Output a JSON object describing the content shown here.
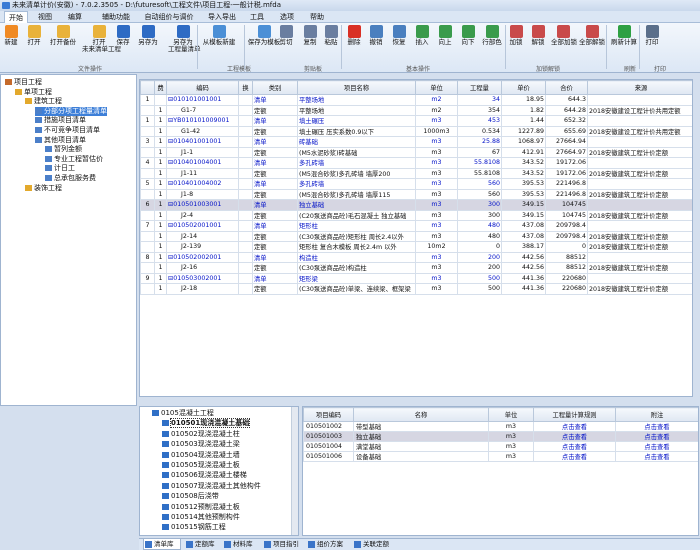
{
  "window": {
    "title": "未来清单计价(安徽) - 7.0.2.3505 - D:\\futuresoft\\工程文件\\项目工程-一般计税.mfda"
  },
  "tabs": [
    "开始",
    "视图",
    "编算",
    "辅助功能",
    "自动组价与调价",
    "导入导出",
    "工具",
    "选项",
    "帮助"
  ],
  "ribbon": {
    "buttons": [
      {
        "label": "新建",
        "icon": "new-file-icon",
        "color": "#f08a24"
      },
      {
        "label": "打开",
        "icon": "open-folder-icon",
        "color": "#e9b23a"
      },
      {
        "label": "打开备份",
        "icon": "backup-folder-icon",
        "color": "#e9b23a"
      },
      {
        "label": "打开\n未来清单工程",
        "icon": "open-project-icon",
        "color": "#e9b23a"
      },
      {
        "label": "保存",
        "icon": "save-icon",
        "color": "#2e6bc4"
      },
      {
        "label": "另存为",
        "icon": "save-as-icon",
        "color": "#2e6bc4"
      },
      {
        "label": "另存为\n工程量清单",
        "icon": "save-as-list-icon",
        "color": "#2e6bc4"
      },
      {
        "label": "从模板新建",
        "icon": "template-new-icon",
        "color": "#4b8fd6"
      },
      {
        "label": "保存为模板",
        "icon": "save-template-icon",
        "color": "#4b8fd6"
      },
      {
        "label": "剪切",
        "icon": "cut-icon",
        "color": "#6a7ea0"
      },
      {
        "label": "复制",
        "icon": "copy-icon",
        "color": "#6a7ea0"
      },
      {
        "label": "粘贴",
        "icon": "paste-icon",
        "color": "#6a7ea0"
      },
      {
        "label": "删除",
        "icon": "delete-icon",
        "color": "#d93025"
      },
      {
        "label": "撤销",
        "icon": "undo-icon",
        "color": "#4a7fbf"
      },
      {
        "label": "恢复",
        "icon": "redo-icon",
        "color": "#4a7fbf"
      },
      {
        "label": "插入",
        "icon": "insert-icon",
        "color": "#3a9b4c"
      },
      {
        "label": "向上",
        "icon": "move-up-icon",
        "color": "#3a9b4c"
      },
      {
        "label": "向下",
        "icon": "move-down-icon",
        "color": "#3a9b4c"
      },
      {
        "label": "行部色",
        "icon": "row-color-icon",
        "color": "#3a9b4c"
      },
      {
        "label": "加锁",
        "icon": "lock-icon",
        "color": "#c94a4a"
      },
      {
        "label": "解锁",
        "icon": "unlock-icon",
        "color": "#c94a4a"
      },
      {
        "label": "全部加锁",
        "icon": "lock-all-icon",
        "color": "#c94a4a"
      },
      {
        "label": "全部解锁",
        "icon": "unlock-all-icon",
        "color": "#c94a4a"
      },
      {
        "label": "刷新计算",
        "icon": "refresh-icon",
        "color": "#2ea043"
      },
      {
        "label": "打印",
        "icon": "print-icon",
        "color": "#5b6f8a"
      }
    ],
    "groups": [
      "文件操作",
      "工程模板",
      "剪贴板",
      "基本操作",
      "加锁解锁",
      "刷新",
      "打印"
    ]
  },
  "tree": {
    "items": [
      {
        "label": "项目工程",
        "level": 0,
        "icon": "project-icon"
      },
      {
        "label": "单项工程",
        "level": 1,
        "icon": "folder-icon"
      },
      {
        "label": "建筑工程",
        "level": 2,
        "icon": "folder-icon"
      },
      {
        "label": "分部分项工程量清单",
        "level": 3,
        "icon": "doc-icon",
        "selected": true
      },
      {
        "label": "措施项目清单",
        "level": 3,
        "icon": "doc-icon"
      },
      {
        "label": "不可竞争项目清单",
        "level": 3,
        "icon": "doc-icon"
      },
      {
        "label": "其他项目清单",
        "level": 3,
        "icon": "doc-icon"
      },
      {
        "label": "暂列金额",
        "level": 4,
        "icon": "doc-icon"
      },
      {
        "label": "专业工程暂估价",
        "level": 4,
        "icon": "doc-icon"
      },
      {
        "label": "计日工",
        "level": 4,
        "icon": "doc-icon"
      },
      {
        "label": "总承包服务费",
        "level": 4,
        "icon": "doc-icon"
      },
      {
        "label": "装饰工程",
        "level": 2,
        "icon": "folder-icon"
      }
    ]
  },
  "grid": {
    "headers": [
      "",
      "费",
      "编码",
      "换",
      "类别",
      "项目名称",
      "单位",
      "工程量",
      "单价",
      "合价",
      "来源"
    ],
    "rows": [
      [
        "1",
        "",
        "⊟010101001001",
        "",
        "清单",
        "平整场地",
        "m2",
        "34",
        "18.95",
        "644.3",
        "",
        "b"
      ],
      [
        "",
        "1",
        "G1-7",
        "",
        "定额",
        "平整场地",
        "m2",
        "354",
        "1.82",
        "644.28",
        "2018安徽建设工程计价共用定额",
        "n"
      ],
      [
        "1",
        "1",
        "⊟YB010101009001",
        "",
        "清单",
        "填土碾压",
        "m3",
        "453",
        "1.44",
        "652.32",
        "",
        "b"
      ],
      [
        "",
        "1",
        "G1-42",
        "",
        "定额",
        "填土碾压 压实系数0.9以下",
        "1000m3",
        "0.534",
        "1227.89",
        "655.69",
        "2018安徽建设工程计价共用定额",
        "n"
      ],
      [
        "3",
        "1",
        "⊟010401001001",
        "",
        "清单",
        "砖基础",
        "m3",
        "25.88",
        "1068.97",
        "27664.94",
        "",
        "b"
      ],
      [
        "",
        "1",
        "J1-1",
        "",
        "定额",
        "(M5水泥砂浆)砖基础",
        "m3",
        "67",
        "412.91",
        "27664.97",
        "2018安徽建筑工程计价定额",
        "n"
      ],
      [
        "4",
        "1",
        "⊟010401004001",
        "",
        "清单",
        "多孔砖墙",
        "m3",
        "55.8108",
        "343.52",
        "19172.06",
        "",
        "b"
      ],
      [
        "",
        "1",
        "J1-11",
        "",
        "定额",
        "(M5混合砂浆)多孔砖墙 墙厚200",
        "m3",
        "55.8108",
        "343.52",
        "19172.06",
        "2018安徽建筑工程计价定额",
        "n"
      ],
      [
        "5",
        "1",
        "⊟010401004002",
        "",
        "清单",
        "多孔砖墙",
        "m3",
        "560",
        "395.53",
        "221496.8",
        "",
        "b"
      ],
      [
        "",
        "1",
        "J1-8",
        "",
        "定额",
        "(M5混合砂浆)多孔砖墙 墙厚115",
        "m3",
        "560",
        "395.53",
        "221496.8",
        "2018安徽建筑工程计价定额",
        "n"
      ],
      [
        "6",
        "1",
        "⊟010501003001",
        "",
        "清单",
        "独立基础",
        "m3",
        "300",
        "349.15",
        "104745",
        "",
        "h"
      ],
      [
        "",
        "1",
        "J2-4",
        "",
        "定额",
        "(C20泵送商品砼)毛石混凝土 独立基础",
        "m3",
        "300",
        "349.15",
        "104745",
        "2018安徽建筑工程计价定额",
        "n"
      ],
      [
        "7",
        "1",
        "⊟010502001001",
        "",
        "清单",
        "矩形柱",
        "m3",
        "480",
        "437.08",
        "209798.4",
        "",
        "b"
      ],
      [
        "",
        "1",
        "J2-14",
        "",
        "定额",
        "(C30泵送商品砼)矩形柱 周长2.4以外",
        "m3",
        "480",
        "437.08",
        "209798.4",
        "2018安徽建筑工程计价定额",
        "n"
      ],
      [
        "",
        "1",
        "J2-139",
        "",
        "定额",
        "矩形柱 复合木模板 周长2.4m 以外",
        "10m2",
        "0",
        "388.17",
        "0",
        "2018安徽建筑工程计价定额",
        "n"
      ],
      [
        "8",
        "1",
        "⊟010502002001",
        "",
        "清单",
        "构造柱",
        "m3",
        "200",
        "442.56",
        "88512",
        "",
        "b"
      ],
      [
        "",
        "1",
        "J2-16",
        "",
        "定额",
        "(C30泵送商品砼)构造柱",
        "m3",
        "200",
        "442.56",
        "88512",
        "2018安徽建筑工程计价定额",
        "n"
      ],
      [
        "9",
        "1",
        "⊟010503002001",
        "",
        "清单",
        "矩形梁",
        "m3",
        "500",
        "441.36",
        "220680",
        "",
        "b"
      ],
      [
        "",
        "1",
        "J2-18",
        "",
        "定额",
        "(C30泵送商品砼)单梁、连续梁、框架梁",
        "m3",
        "500",
        "441.36",
        "220680",
        "2018安徽建筑工程计价定额",
        "n"
      ]
    ]
  },
  "lib_tree": {
    "items": [
      {
        "label": "0105混凝土工程",
        "level": 0
      },
      {
        "label": "010501现浇混凝土基础",
        "level": 1,
        "selected": true
      },
      {
        "label": "010502现浇混凝土柱",
        "level": 1
      },
      {
        "label": "010503现浇混凝土梁",
        "level": 1
      },
      {
        "label": "010504现浇混凝土墙",
        "level": 1
      },
      {
        "label": "010505现浇混凝土板",
        "level": 1
      },
      {
        "label": "010506现浇混凝土楼梯",
        "level": 1
      },
      {
        "label": "010507现浇混凝土其他构件",
        "level": 1
      },
      {
        "label": "010508后浇带",
        "level": 1
      },
      {
        "label": "010512预制混凝土板",
        "level": 1
      },
      {
        "label": "010514其他预制构件",
        "level": 1
      },
      {
        "label": "010515钢筋工程",
        "level": 1
      }
    ]
  },
  "lib_list": {
    "headers": [
      "项目编码",
      "名称",
      "单位",
      "工程量计算规则",
      "附注"
    ],
    "rows": [
      [
        "010501002",
        "带型基础",
        "m3",
        "点击查看",
        "点击查看"
      ],
      [
        "010501003",
        "独立基础",
        "m3",
        "点击查看",
        "点击查看"
      ],
      [
        "010501004",
        "满堂基础",
        "m3",
        "点击查看",
        "点击查看"
      ],
      [
        "010501006",
        "设备基础",
        "m3",
        "点击查看",
        "点击查看"
      ]
    ],
    "selected_index": 1
  },
  "bottom_tabs": [
    "清单库",
    "定额库",
    "材料库",
    "项目指引",
    "组价方案",
    "关联定额"
  ]
}
